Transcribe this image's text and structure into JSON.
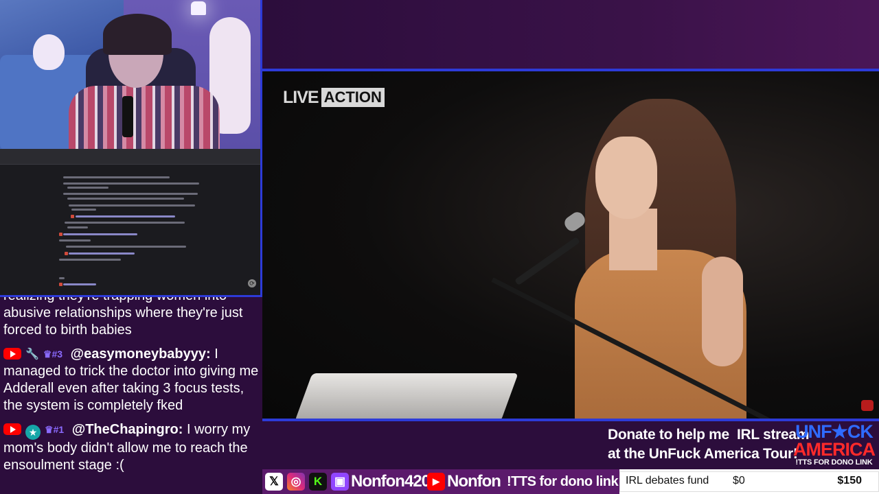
{
  "chat": {
    "partial_line": "realizing they're trapping women into",
    "msg0_text": "abusive relationships where they're just forced to birth babies",
    "messages": [
      {
        "username": "@easymoneybabyyy:",
        "text": "I managed to trick the doctor into giving me Adderall even after taking 3 focus tests, the system is completely fked",
        "badges": [
          "youtube-icon",
          "wrench-icon",
          "crown-badge-3"
        ],
        "badge_label": "#3"
      },
      {
        "username": "@TheChapingro:",
        "text": "I worry my mom's body didn't allow me to reach the ensoulment stage :(",
        "badges": [
          "youtube-icon",
          "star-icon",
          "crown-badge-1"
        ],
        "badge_label": "#1"
      }
    ]
  },
  "video": {
    "logo_live": "LIVE",
    "logo_action": "ACTION"
  },
  "donate": {
    "line1": "Donate to help me  IRL stream",
    "line2": "at the UnFuck America Tour!",
    "brand_line1": "UNF★CK",
    "brand_line2": "AMERICA",
    "brand_line3": "!TTS FOR DONO LINK"
  },
  "social": {
    "handle1": "Nonfon420",
    "handle2": "Nonfon",
    "tts": "!TTS for dono link",
    "icons": [
      "x-icon",
      "instagram-icon",
      "kick-icon",
      "twitch-icon",
      "youtube-icon"
    ]
  },
  "fund": {
    "label": "IRL debates fund",
    "current": "$0",
    "goal": "$150",
    "progress": 0
  },
  "colors": {
    "accent_blue": "#2d3bd8",
    "panel_purple": "#2c0d3c",
    "youtube_red": "#ff0000",
    "brand_blue": "#2f6bff",
    "brand_red": "#ff2a2a"
  }
}
